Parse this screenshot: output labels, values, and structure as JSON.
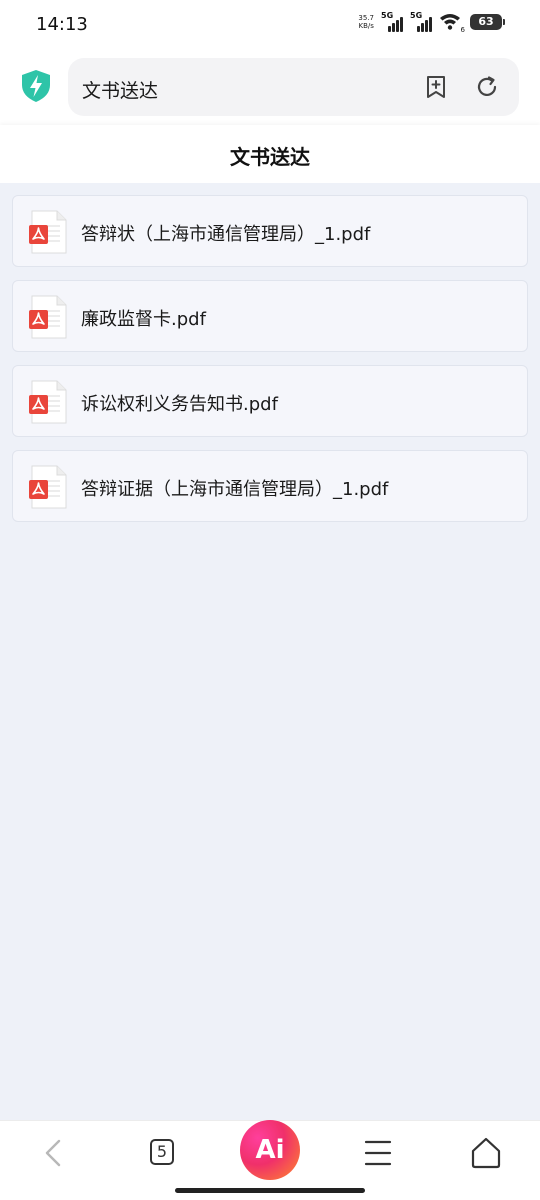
{
  "status_bar": {
    "time": "14:13",
    "net_speed_value": "35.7",
    "net_speed_unit": "KB/s",
    "signal1_label": "5G",
    "signal2_label": "5G",
    "wifi_label": "6",
    "battery": "63"
  },
  "browser": {
    "url_text": "文书送达"
  },
  "page": {
    "title": "文书送达"
  },
  "files": [
    {
      "name": "答辩状（上海市通信管理局）_1.pdf"
    },
    {
      "name": "廉政监督卡.pdf"
    },
    {
      "name": "诉讼权利义务告知书.pdf"
    },
    {
      "name": "答辩证据（上海市通信管理局）_1.pdf"
    }
  ],
  "bottom_nav": {
    "tab_count": "5",
    "ai_label": "Ai"
  },
  "colors": {
    "content_bg": "#eef1f8",
    "pdf_red": "#e9453b",
    "shield_teal": "#2ec4a8"
  },
  "icons": {
    "shield": "shield-bolt-icon",
    "bookmark": "bookmark-add-icon",
    "reload": "reload-icon",
    "pdf": "pdf-file-icon",
    "back": "chevron-left-icon",
    "menu": "hamburger-menu-icon",
    "home": "home-icon"
  }
}
